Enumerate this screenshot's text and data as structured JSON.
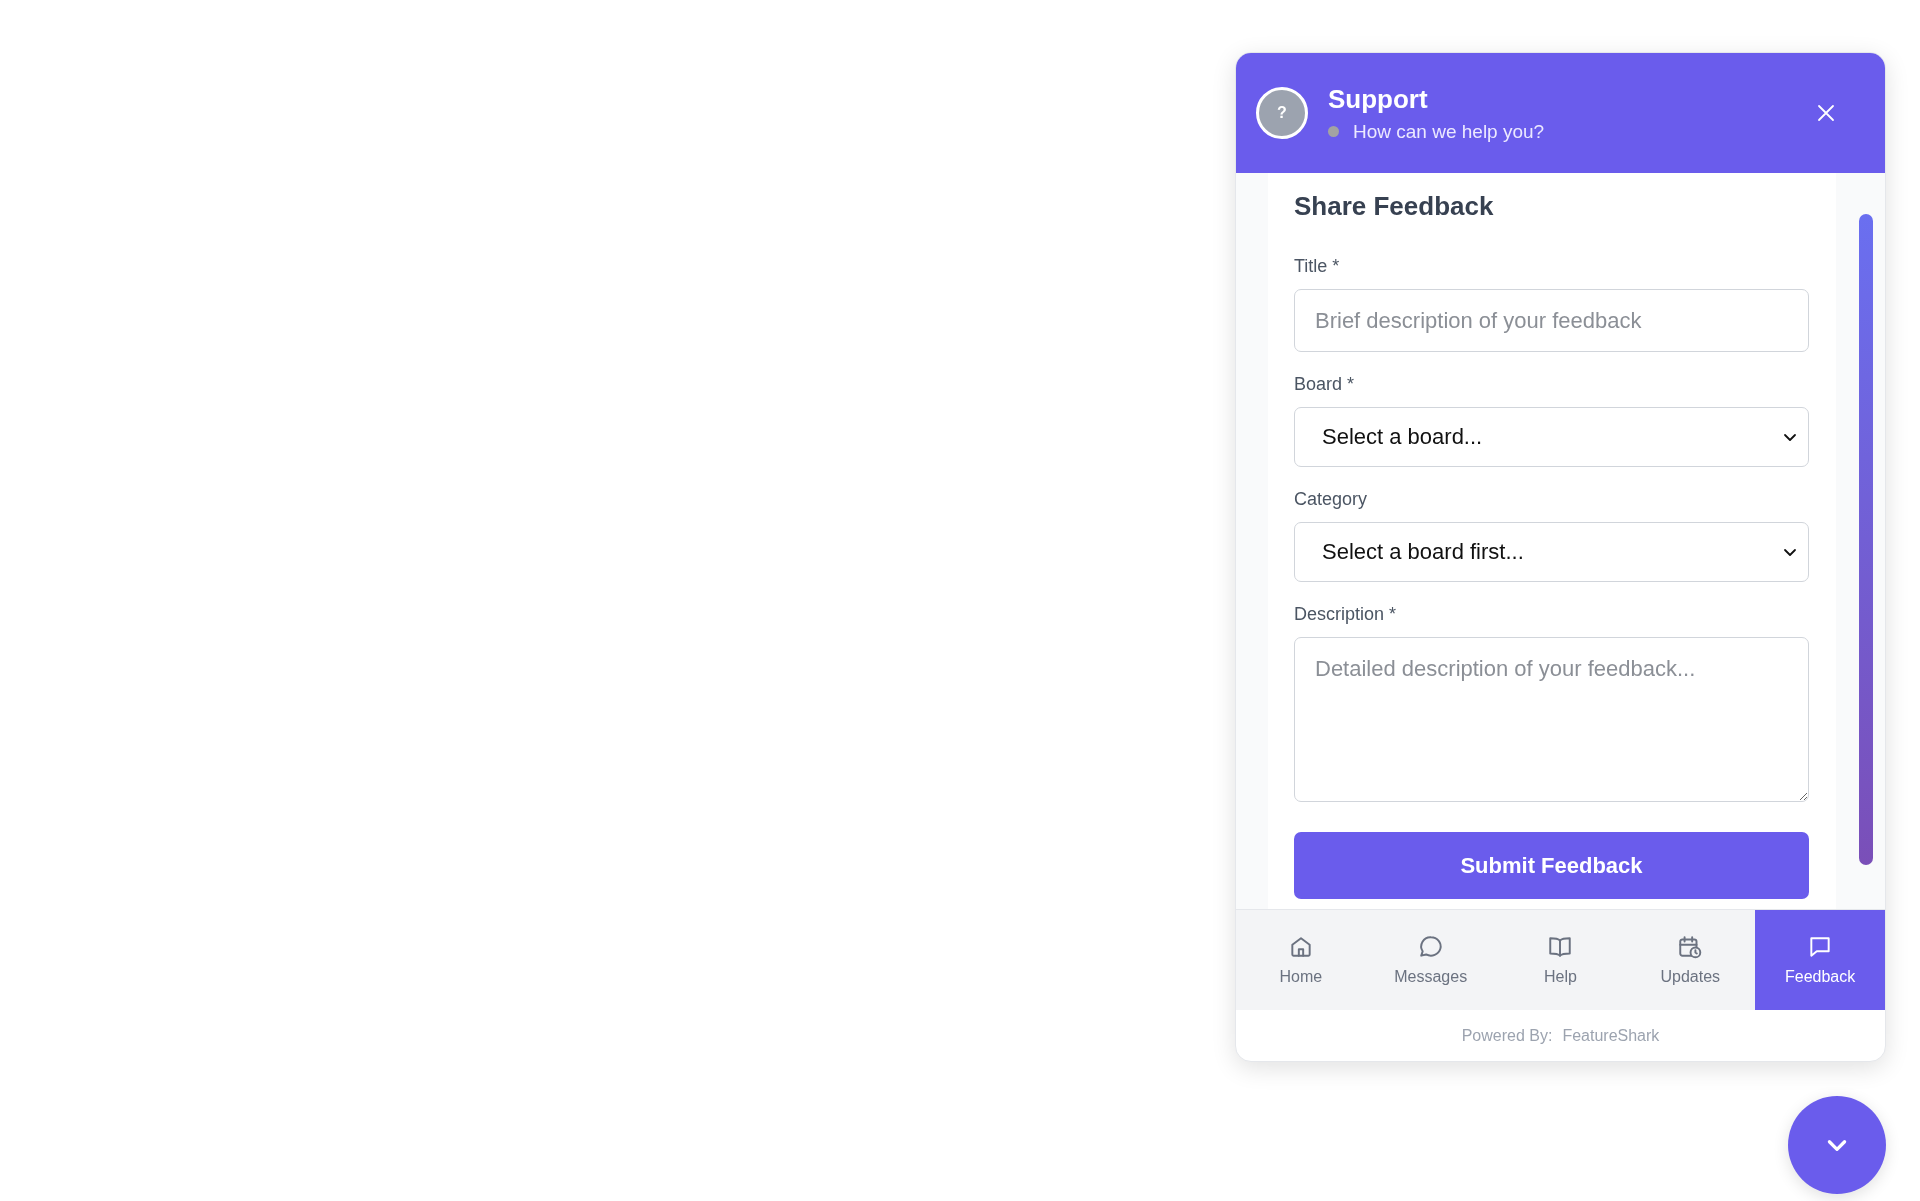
{
  "header": {
    "avatar": "?",
    "title": "Support",
    "online": false,
    "subtitle": "How can we help you?"
  },
  "form": {
    "heading": "Share Feedback",
    "fields": [
      {
        "kind": "text",
        "label": "Title *",
        "placeholder": "Brief description of your feedback"
      },
      {
        "kind": "select",
        "label": "Board *",
        "value": "Select a board..."
      },
      {
        "kind": "select",
        "label": "Category",
        "value": "Select a board first..."
      },
      {
        "kind": "textarea",
        "label": "Description *",
        "placeholder": "Detailed description of your feedback..."
      }
    ],
    "submit": "Submit Feedback"
  },
  "nav": [
    {
      "label": "Home",
      "selected": false
    },
    {
      "label": "Messages",
      "selected": false
    },
    {
      "label": "Help",
      "selected": false
    },
    {
      "label": "Updates",
      "selected": false
    },
    {
      "label": "Feedback",
      "selected": true
    }
  ],
  "footer": {
    "prefix": "Powered By:",
    "brand": "FeatureShark"
  }
}
